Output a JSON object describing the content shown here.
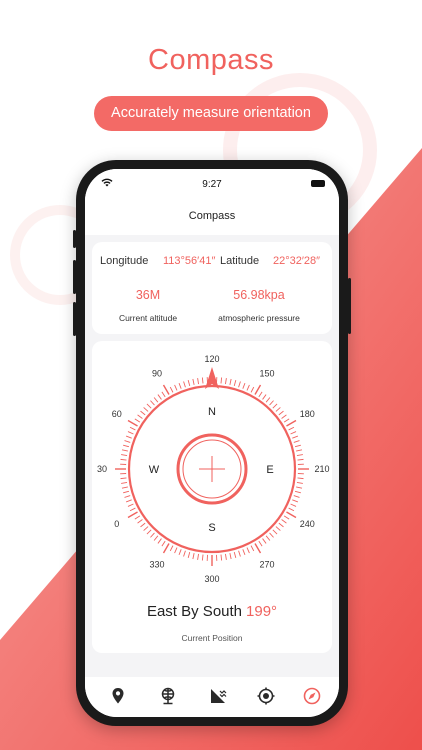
{
  "promo": {
    "title": "Compass",
    "subtitle": "Accurately measure orientation"
  },
  "status_bar": {
    "time": "9:27"
  },
  "app": {
    "title": "Compass"
  },
  "location": {
    "longitude_label": "Longitude",
    "longitude_value": "113°56′41″",
    "latitude_label": "Latitude",
    "latitude_value": "22°32′28″"
  },
  "environment": {
    "altitude_value": "36M",
    "altitude_label": "Current altitude",
    "pressure_value": "56.98kpa",
    "pressure_label": "atmospheric pressure"
  },
  "compass": {
    "heading_deg": 120,
    "cardinals": {
      "north": "N",
      "east": "E",
      "south": "S",
      "west": "W"
    },
    "outer_labels": [
      {
        "text": "120",
        "deg": 0
      },
      {
        "text": "150",
        "deg": 30
      },
      {
        "text": "180",
        "deg": 60
      },
      {
        "text": "210",
        "deg": 90
      },
      {
        "text": "240",
        "deg": 120
      },
      {
        "text": "270",
        "deg": 150
      },
      {
        "text": "300",
        "deg": 180
      },
      {
        "text": "330",
        "deg": 210
      },
      {
        "text": "0",
        "deg": 240
      },
      {
        "text": "30",
        "deg": 270
      },
      {
        "text": "60",
        "deg": 300
      },
      {
        "text": "90",
        "deg": 330
      }
    ],
    "direction_name": "East By South",
    "direction_degree": "199°",
    "caption": "Current Position"
  },
  "tabs": [
    {
      "name": "location-pin-icon",
      "active": false
    },
    {
      "name": "globe-icon",
      "active": false
    },
    {
      "name": "altitude-chart-icon",
      "active": false
    },
    {
      "name": "target-icon",
      "active": false
    },
    {
      "name": "compass-arrow-icon",
      "active": true
    }
  ],
  "colors": {
    "accent": "#f0625e",
    "text": "#222222",
    "muted": "#555555",
    "screen_bg": "#f4f4f6"
  }
}
